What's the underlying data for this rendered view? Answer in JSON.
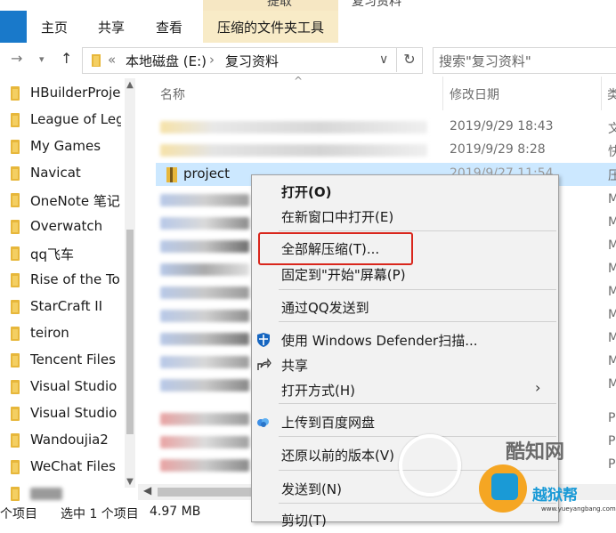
{
  "ribbon": {
    "file_tab": "",
    "tabs": [
      "主页",
      "共享",
      "查看"
    ],
    "context_tab": "压缩的文件夹工具",
    "context_group": "提取",
    "title_partial": "复习资料"
  },
  "address": {
    "prefix": "«",
    "crumbs": [
      "本地磁盘 (E:)",
      "复习资料"
    ],
    "search_placeholder": "搜索\"复习资料\""
  },
  "sidebar": {
    "items": [
      "HBuilderProje",
      "League of Leg",
      "My Games",
      "Navicat",
      "OneNote 笔记",
      "Overwatch",
      "qq飞车",
      "Rise of the To",
      "StarCraft II",
      "teiron",
      "Tencent Files",
      "Visual Studio",
      "Visual Studio",
      "Wandoujia2",
      "WeChat Files"
    ]
  },
  "list": {
    "columns": [
      "名称",
      "修改日期",
      "类"
    ],
    "rows": [
      {
        "name": "",
        "date": "2019/9/29 18:43",
        "type": "文"
      },
      {
        "name": "",
        "date": "2019/9/29 8:28",
        "type": "快"
      },
      {
        "name": "project",
        "date": "2019/9/27 11:54",
        "type": "压"
      },
      {
        "type": "M"
      },
      {
        "type": "M"
      },
      {
        "type": "M"
      },
      {
        "type": "M"
      },
      {
        "type": "M"
      },
      {
        "type": "M"
      },
      {
        "type": "M"
      },
      {
        "type": "M"
      },
      {
        "type": "M"
      },
      {
        "type": "P"
      },
      {
        "type": "P"
      },
      {
        "type": "P"
      }
    ]
  },
  "context_menu": {
    "items": [
      {
        "label": "打开(O)",
        "bold": true
      },
      {
        "label": "在新窗口中打开(E)"
      },
      {
        "label": "全部解压缩(T)..."
      },
      {
        "label": "固定到\"开始\"屏幕(P)"
      },
      {
        "label": "通过QQ发送到"
      },
      {
        "label": "使用 Windows Defender扫描...",
        "icon": "defender-icon"
      },
      {
        "label": "共享",
        "icon": "share-icon"
      },
      {
        "label": "打开方式(H)",
        "submenu": true
      },
      {
        "label": "上传到百度网盘",
        "icon": "baidu-cloud-icon"
      },
      {
        "label": "还原以前的版本(V)"
      },
      {
        "label": "发送到(N)"
      },
      {
        "label": "剪切(T)"
      }
    ]
  },
  "status": {
    "count": "个项目",
    "selected": "选中 1 个项目",
    "size": "4.97 MB"
  },
  "watermark": {
    "brand": "酷知网",
    "brand2": "越狱帮",
    "url": "www.yueyangbang.com"
  },
  "colors": {
    "accent": "#1979ca",
    "selection": "#cce8ff",
    "highlight_box": "#d9261c",
    "ribbon_context": "#f8ebc7"
  }
}
